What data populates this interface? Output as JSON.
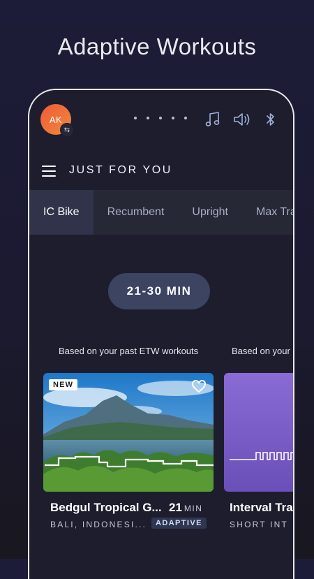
{
  "headline": "Adaptive Workouts",
  "profile": {
    "initials": "AK",
    "swap_icon": "⇆"
  },
  "top_icons": [
    "dots-indicator-icon",
    "music-note-icon",
    "speaker-volume-icon",
    "bluetooth-icon"
  ],
  "section_title": "JUST FOR YOU",
  "tabs": [
    "IC Bike",
    "Recumbent",
    "Upright",
    "Max Trainer"
  ],
  "active_tab": "IC Bike",
  "duration": "21-30 MIN",
  "rows": [
    {
      "caption": "Based on your past ETW workouts",
      "card": {
        "badge": "NEW",
        "title": "Bedgul Tropical G...",
        "minutes": "21",
        "minutes_unit": "MIN",
        "location": "BALI, INDONESI...",
        "tag": "ADAPTIVE"
      }
    },
    {
      "caption": "Based on your",
      "card": {
        "title": "Interval Tra",
        "location": "SHORT INT"
      }
    }
  ],
  "colors": {
    "background": "#1c1c38",
    "phone_bg": "#1d1d2d",
    "tabs_bg": "#262836",
    "active_tab_bg": "#30334a",
    "duration_pill": "#3d4462",
    "avatar_gradient": [
      "#ef5a3b",
      "#f08a3a"
    ],
    "interval_card": "#7b5fc7"
  }
}
